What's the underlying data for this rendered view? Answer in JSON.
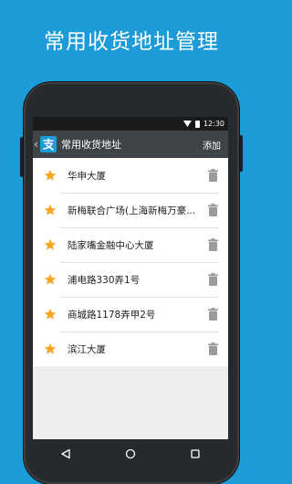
{
  "promo": {
    "title": "常用收货地址管理"
  },
  "status_bar": {
    "time": "12:30"
  },
  "app_bar": {
    "back_icon": "chevron-left-icon",
    "logo_icon": "alipay-logo-icon",
    "title": "常用收货地址",
    "add_label": "添加"
  },
  "addresses": [
    {
      "name": "华申大厦"
    },
    {
      "name": "新梅联合广场(上海新梅万豪..."
    },
    {
      "name": "陆家嘴金融中心大厦"
    },
    {
      "name": "浦电路330弄1号"
    },
    {
      "name": "商城路1178弄甲2号"
    },
    {
      "name": "滨江大厦"
    }
  ],
  "nav_bar": {
    "back": "triangle-back-icon",
    "home": "circle-home-icon",
    "recents": "square-recents-icon"
  },
  "colors": {
    "background": "#1b9bd8",
    "star": "#f5a623",
    "appbar": "#3f4448",
    "trash": "#9b9b9b"
  }
}
